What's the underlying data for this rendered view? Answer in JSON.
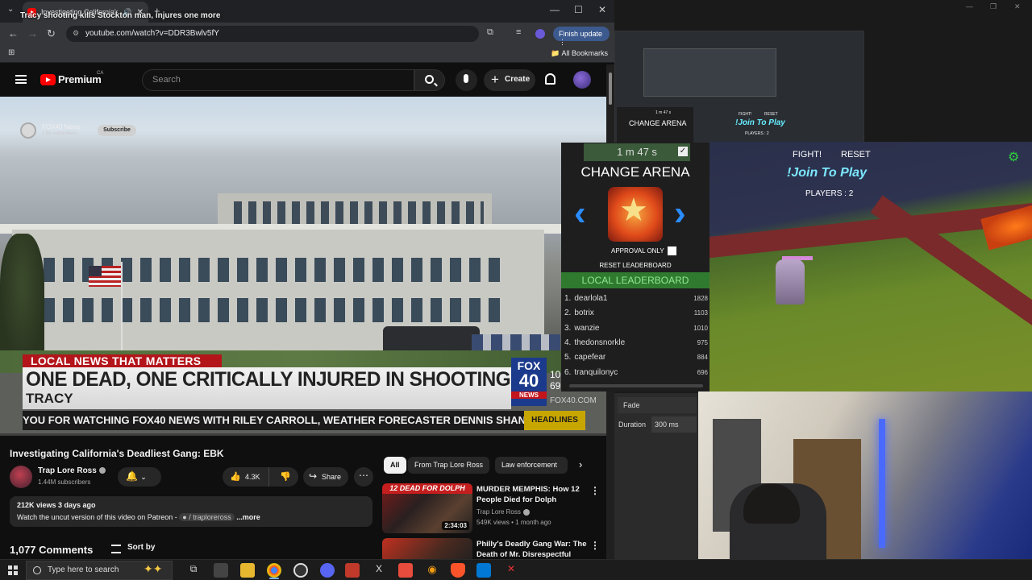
{
  "browser": {
    "tab_title": "Investigating California's De",
    "url": "youtube.com/watch?v=DDR3Bwlv5fY",
    "finish_update": "Finish update",
    "all_bookmarks": "All Bookmarks"
  },
  "youtube": {
    "brand": "Premium",
    "region": "CA",
    "search_placeholder": "Search",
    "create": "Create"
  },
  "video": {
    "overlay_title": "Tracy shooting kills Stockton man, injures one more",
    "overlay_channel": "FOX40 News",
    "overlay_subs": "1.8k subscribers",
    "subscribe": "Subscribe",
    "lower_third_tag": "LOCAL NEWS THAT MATTERS",
    "headline": "ONE DEAD, ONE CRITICALLY INJURED IN SHOOTING",
    "location": "TRACY",
    "fox_top": "FOX",
    "fox_num": "40",
    "fox_news": "NEWS",
    "temp_1": "10",
    "temp_2": "69",
    "fox_url": "FOX40.COM",
    "ticker": "YOU FOR WATCHING FOX40 NEWS WITH RILEY CARROLL, WEATHER FORECASTER DENNIS SHANAHAN",
    "ticker_tag": "HEADLINES"
  },
  "watch": {
    "title": "Investigating California's Deadliest Gang: EBK",
    "channel": "Trap Lore Ross",
    "subscribers": "1.44M subscribers",
    "likes": "4.3K",
    "share": "Share",
    "stats": "212K views  3 days ago",
    "desc_prefix": "Watch the uncut version of this video on Patreon - ",
    "desc_link": "/ traploreross",
    "desc_more": "...more",
    "comments_count": "1,077 Comments",
    "sort_by": "Sort by"
  },
  "chips": [
    "All",
    "From Trap Lore Ross",
    "Law enforcement"
  ],
  "recommendations": [
    {
      "banner": "12 DEAD FOR DOLPH",
      "duration": "2:34:03",
      "title": "MURDER MEMPHIS: How 12 People Died for Dolph",
      "channel": "Trap Lore Ross",
      "meta": "549K views  •  1 month ago"
    },
    {
      "title": "Philly's Deadly Gang War: The Death of Mr. Disrespectful"
    }
  ],
  "nested": {
    "timer": "1 m 47 s",
    "change_arena": "CHANGE ARENA",
    "fight": "FIGHT!",
    "reset": "RESET",
    "join": "!Join To Play",
    "players": "PLAYERS : 2"
  },
  "game": {
    "fight": "FIGHT!",
    "reset": "RESET",
    "join": "!Join To Play",
    "players": "PLAYERS : 2"
  },
  "arena": {
    "timer": "1 m 47 s",
    "title": "CHANGE ARENA",
    "approval_only": "APPROVAL ONLY",
    "reset_leaderboard": "RESET LEADERBOARD",
    "leaderboard_title": "LOCAL LEADERBOARD",
    "leaderboard": [
      {
        "rank": "1.",
        "name": "dearlola1",
        "points": "1828"
      },
      {
        "rank": "2.",
        "name": "botrix",
        "points": "1103"
      },
      {
        "rank": "3.",
        "name": "wanzie",
        "points": "1010"
      },
      {
        "rank": "4.",
        "name": "thedonsnorkle",
        "points": "975"
      },
      {
        "rank": "5.",
        "name": "capefear",
        "points": "884"
      },
      {
        "rank": "6.",
        "name": "tranquilonyc",
        "points": "696"
      }
    ]
  },
  "fade_panel": {
    "fade": "Fade",
    "duration_label": "Duration",
    "duration_value": "300 ms"
  },
  "taskbar": {
    "search_placeholder": "Type here to search"
  },
  "colors": {
    "youtube_red": "#ff0000",
    "leaderboard_green": "#2f7a2f",
    "arrow_blue": "#2a8cff",
    "join_cyan": "#7be8ff"
  }
}
